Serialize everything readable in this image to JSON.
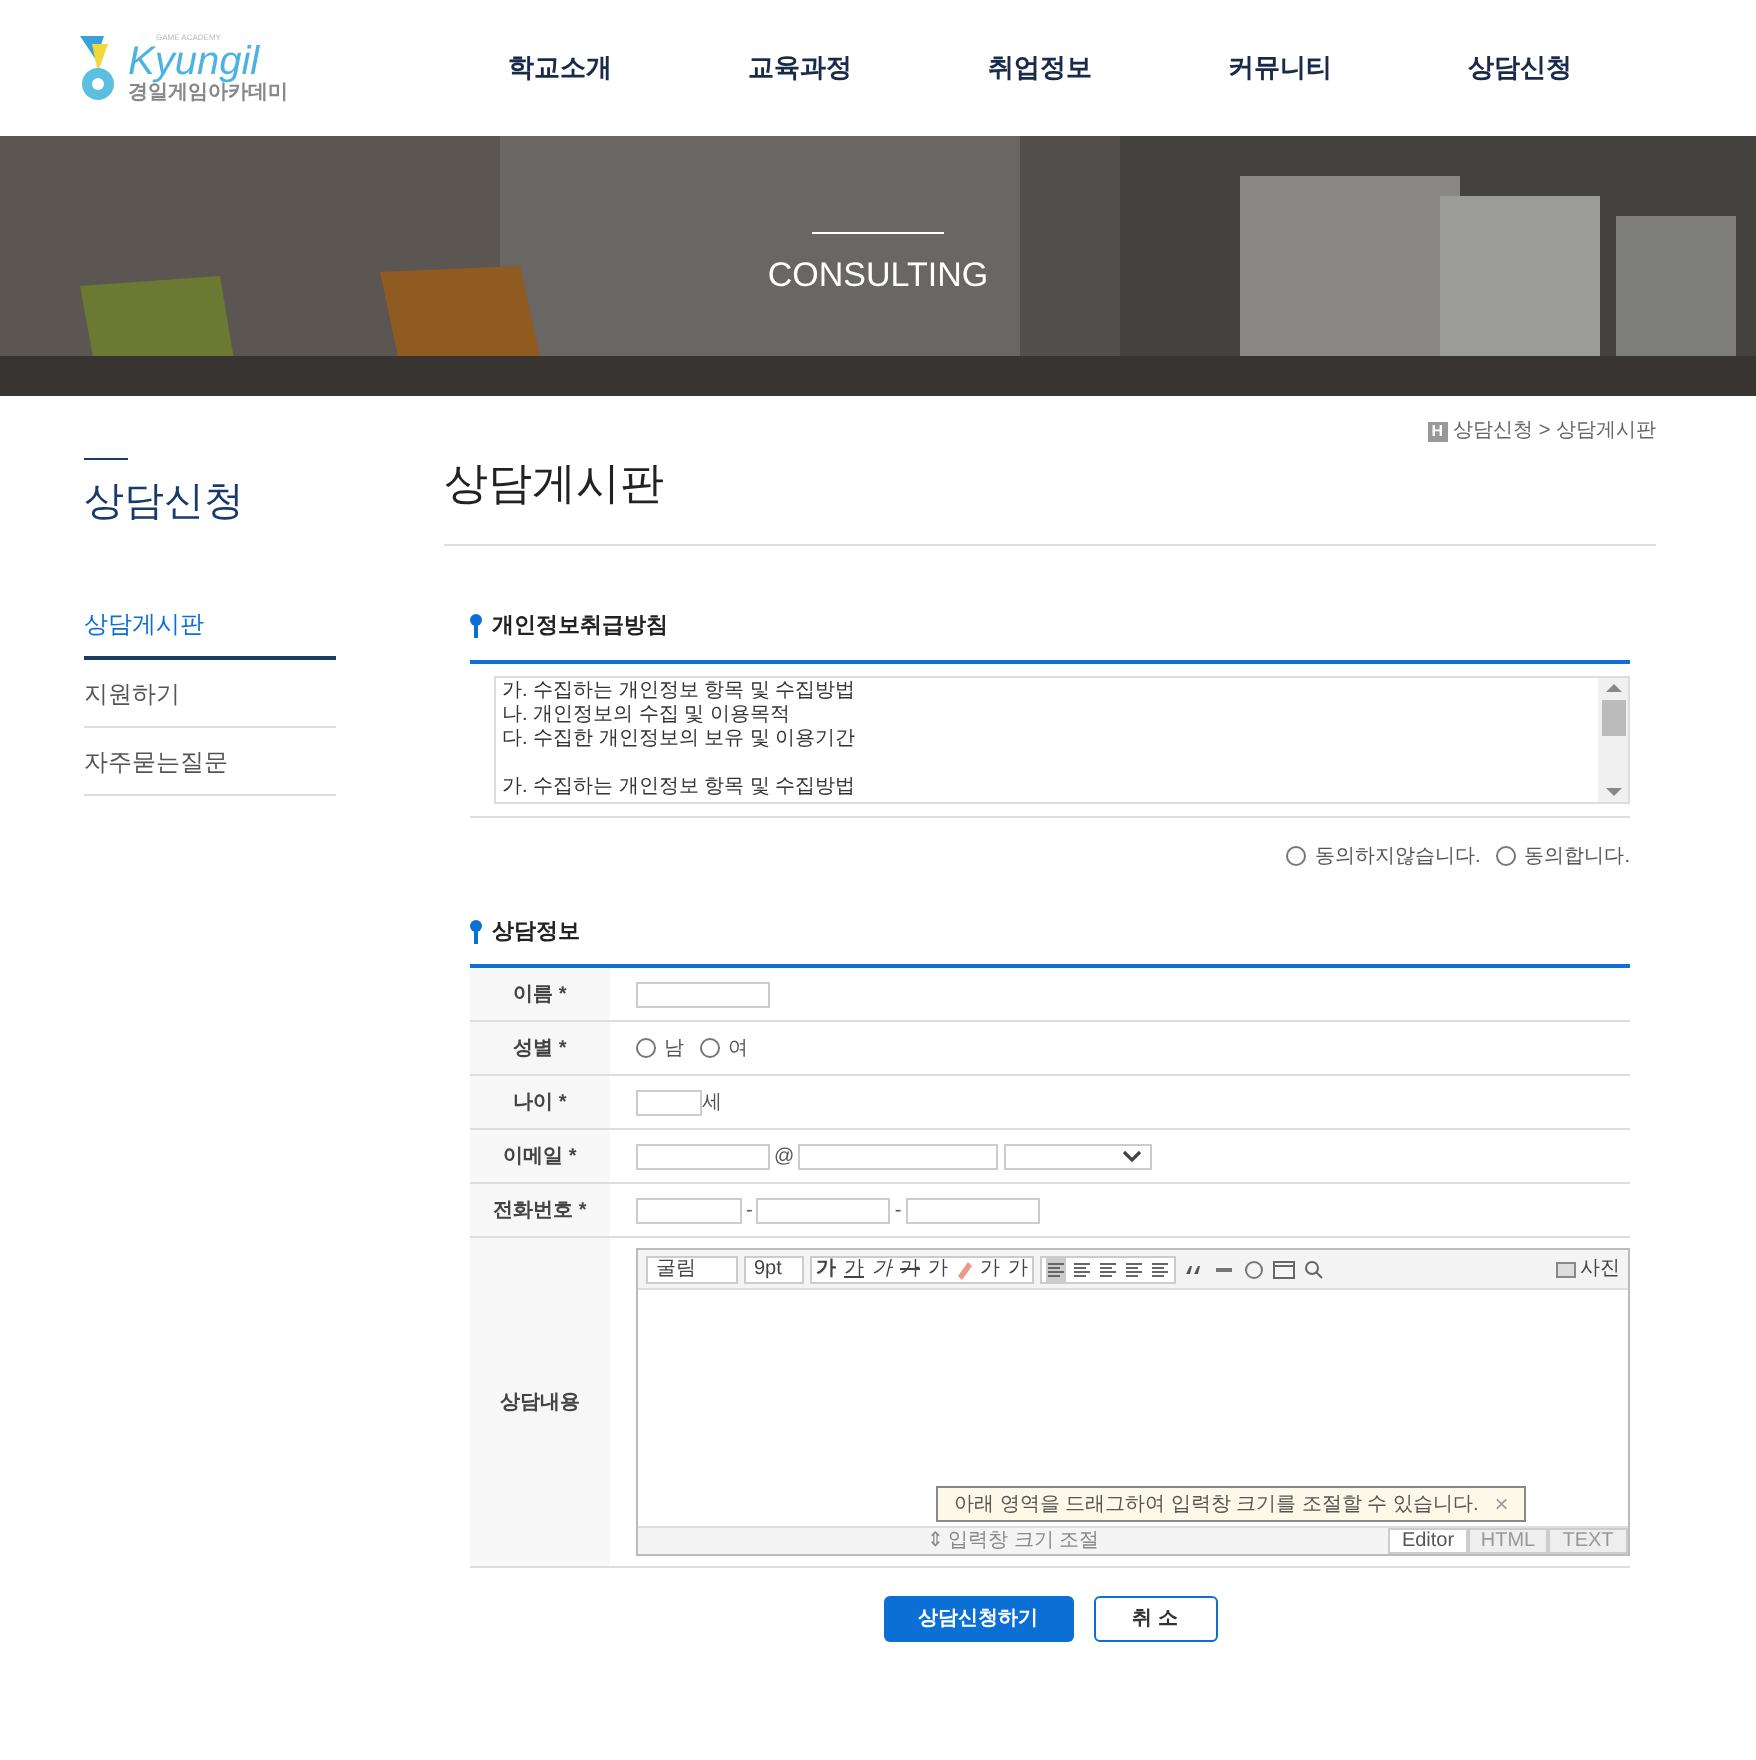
{
  "logo": {
    "brand": "Kyungil",
    "sub": "GAME ACADEMY",
    "name": "경일게임아카데미"
  },
  "nav": [
    "학교소개",
    "교육과정",
    "취업정보",
    "커뮤니티",
    "상담신청"
  ],
  "banner": {
    "title": "CONSULTING"
  },
  "breadcrumb": {
    "icon": "H",
    "path": "상담신청 > 상담게시판"
  },
  "sidebar": {
    "title": "상담신청",
    "items": [
      {
        "label": "상담게시판",
        "selected": true
      },
      {
        "label": "지원하기",
        "selected": false
      },
      {
        "label": "자주묻는질문",
        "selected": false
      }
    ]
  },
  "page_title": "상담게시판",
  "privacy": {
    "heading": "개인정보취급방침",
    "paragraphs": [
      [
        "가. 수집하는 개인정보 항목 및 수집방법",
        "나. 개인정보의 수집 및 이용목적",
        "다. 수집한 개인정보의 보유 및 이용기간"
      ],
      [
        "가. 수집하는 개인정보 항목 및 수집방법"
      ]
    ],
    "options": [
      {
        "label": "동의하지않습니다.",
        "selected": false
      },
      {
        "label": "동의합니다.",
        "selected": false
      }
    ]
  },
  "form": {
    "heading": "상담정보",
    "rows": [
      {
        "kind": "text",
        "label": "이름 *"
      },
      {
        "kind": "radio",
        "label": "성별 *",
        "options": [
          {
            "label": "남",
            "selected": false
          },
          {
            "label": "여",
            "selected": false
          }
        ]
      },
      {
        "kind": "age",
        "label": "나이 *",
        "unit": "세"
      },
      {
        "kind": "email",
        "label": "이메일 *",
        "at": "@"
      },
      {
        "kind": "phone",
        "label": "전화번호 *",
        "sep": "-"
      },
      {
        "kind": "editor",
        "label": "상담내용"
      }
    ]
  },
  "editor": {
    "font": "굴림",
    "size": "9pt",
    "format_buttons": [
      "가",
      "가",
      "가",
      "가",
      "가"
    ],
    "script_buttons": [
      "가",
      "가"
    ],
    "photo": "사진",
    "hint": "아래 영역을 드래그하여 입력창 크기를 조절할 수 있습니다.",
    "hint_close": "×",
    "resize": "⇕ 입력창 크기 조절",
    "tabs": [
      {
        "label": "Editor",
        "selected": true
      },
      {
        "label": "HTML",
        "selected": false
      },
      {
        "label": "TEXT",
        "selected": false
      }
    ]
  },
  "buttons": {
    "submit": "상담신청하기",
    "cancel": "취 소"
  }
}
